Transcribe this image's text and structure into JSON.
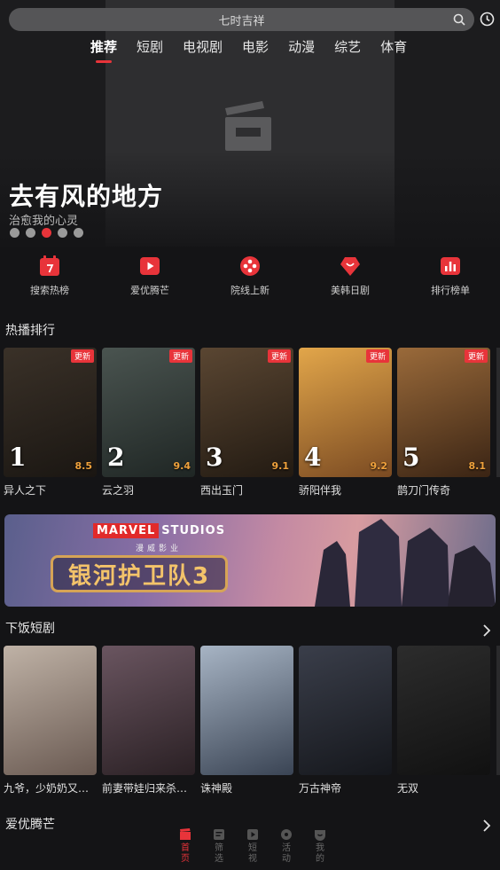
{
  "search": {
    "placeholder": "七时吉祥"
  },
  "icons": {
    "search": "search-icon",
    "history": "clock-icon"
  },
  "tabs": [
    {
      "label": "推荐",
      "active": true
    },
    {
      "label": "短剧"
    },
    {
      "label": "电视剧"
    },
    {
      "label": "电影"
    },
    {
      "label": "动漫"
    },
    {
      "label": "综艺"
    },
    {
      "label": "体育"
    }
  ],
  "hero": {
    "title": "去有风的地方",
    "subtitle": "治愈我的心灵",
    "slide_count": 5,
    "active_slide": 3
  },
  "quick_entries": [
    {
      "label": "搜索热榜",
      "icon": "calendar-icon"
    },
    {
      "label": "爱优腾芒",
      "icon": "play-icon"
    },
    {
      "label": "院线上新",
      "icon": "film-reel-icon"
    },
    {
      "label": "美韩日剧",
      "icon": "heart-diamond-icon"
    },
    {
      "label": "排行榜单",
      "icon": "bar-chart-icon"
    }
  ],
  "hot_rank": {
    "title": "热播排行",
    "badge": "更新",
    "items": [
      {
        "rank": "1",
        "title": "异人之下",
        "score": "8.5",
        "color1": "#3a3128",
        "color2": "#1a1612"
      },
      {
        "rank": "2",
        "title": "云之羽",
        "score": "9.4",
        "color1": "#4a5450",
        "color2": "#1f2624"
      },
      {
        "rank": "3",
        "title": "西出玉门",
        "score": "9.1",
        "color1": "#5a4632",
        "color2": "#221a12"
      },
      {
        "rank": "4",
        "title": "骄阳伴我",
        "score": "9.2",
        "color1": "#e2a64a",
        "color2": "#7a4a22"
      },
      {
        "rank": "5",
        "title": "鹊刀门传奇",
        "score": "8.1",
        "color1": "#9a6a3a",
        "color2": "#3a2414"
      }
    ]
  },
  "promo_banner": {
    "brand": "MARVEL",
    "studios": "STUDIOS",
    "brand_cn": "漫威影业",
    "title": "银河护卫队3"
  },
  "short_drama": {
    "title": "下饭短剧",
    "items": [
      {
        "title": "九爷，少奶奶又…",
        "color1": "#bfb2a6",
        "color2": "#6a5a52"
      },
      {
        "title": "前妻带娃归来杀…",
        "color1": "#6a5560",
        "color2": "#2a2024"
      },
      {
        "title": "诛神殿",
        "color1": "#a7b4c4",
        "color2": "#3a4454"
      },
      {
        "title": "万古神帝",
        "color1": "#3a3e4a",
        "color2": "#15171c"
      },
      {
        "title": "无双",
        "color1": "#2c2c2c",
        "color2": "#111111"
      }
    ]
  },
  "next_section": {
    "title": "爱优腾芒"
  },
  "bottom_nav": [
    {
      "label": "首页",
      "active": true,
      "icon": "clapper-icon"
    },
    {
      "label": "筛选",
      "icon": "list-icon"
    },
    {
      "label": "短视",
      "icon": "video-icon"
    },
    {
      "label": "活动",
      "icon": "circle-icon"
    },
    {
      "label": "我的",
      "icon": "profile-icon"
    }
  ],
  "colors": {
    "accent": "#e8343a",
    "score": "#f0a23c",
    "background": "#141416"
  }
}
